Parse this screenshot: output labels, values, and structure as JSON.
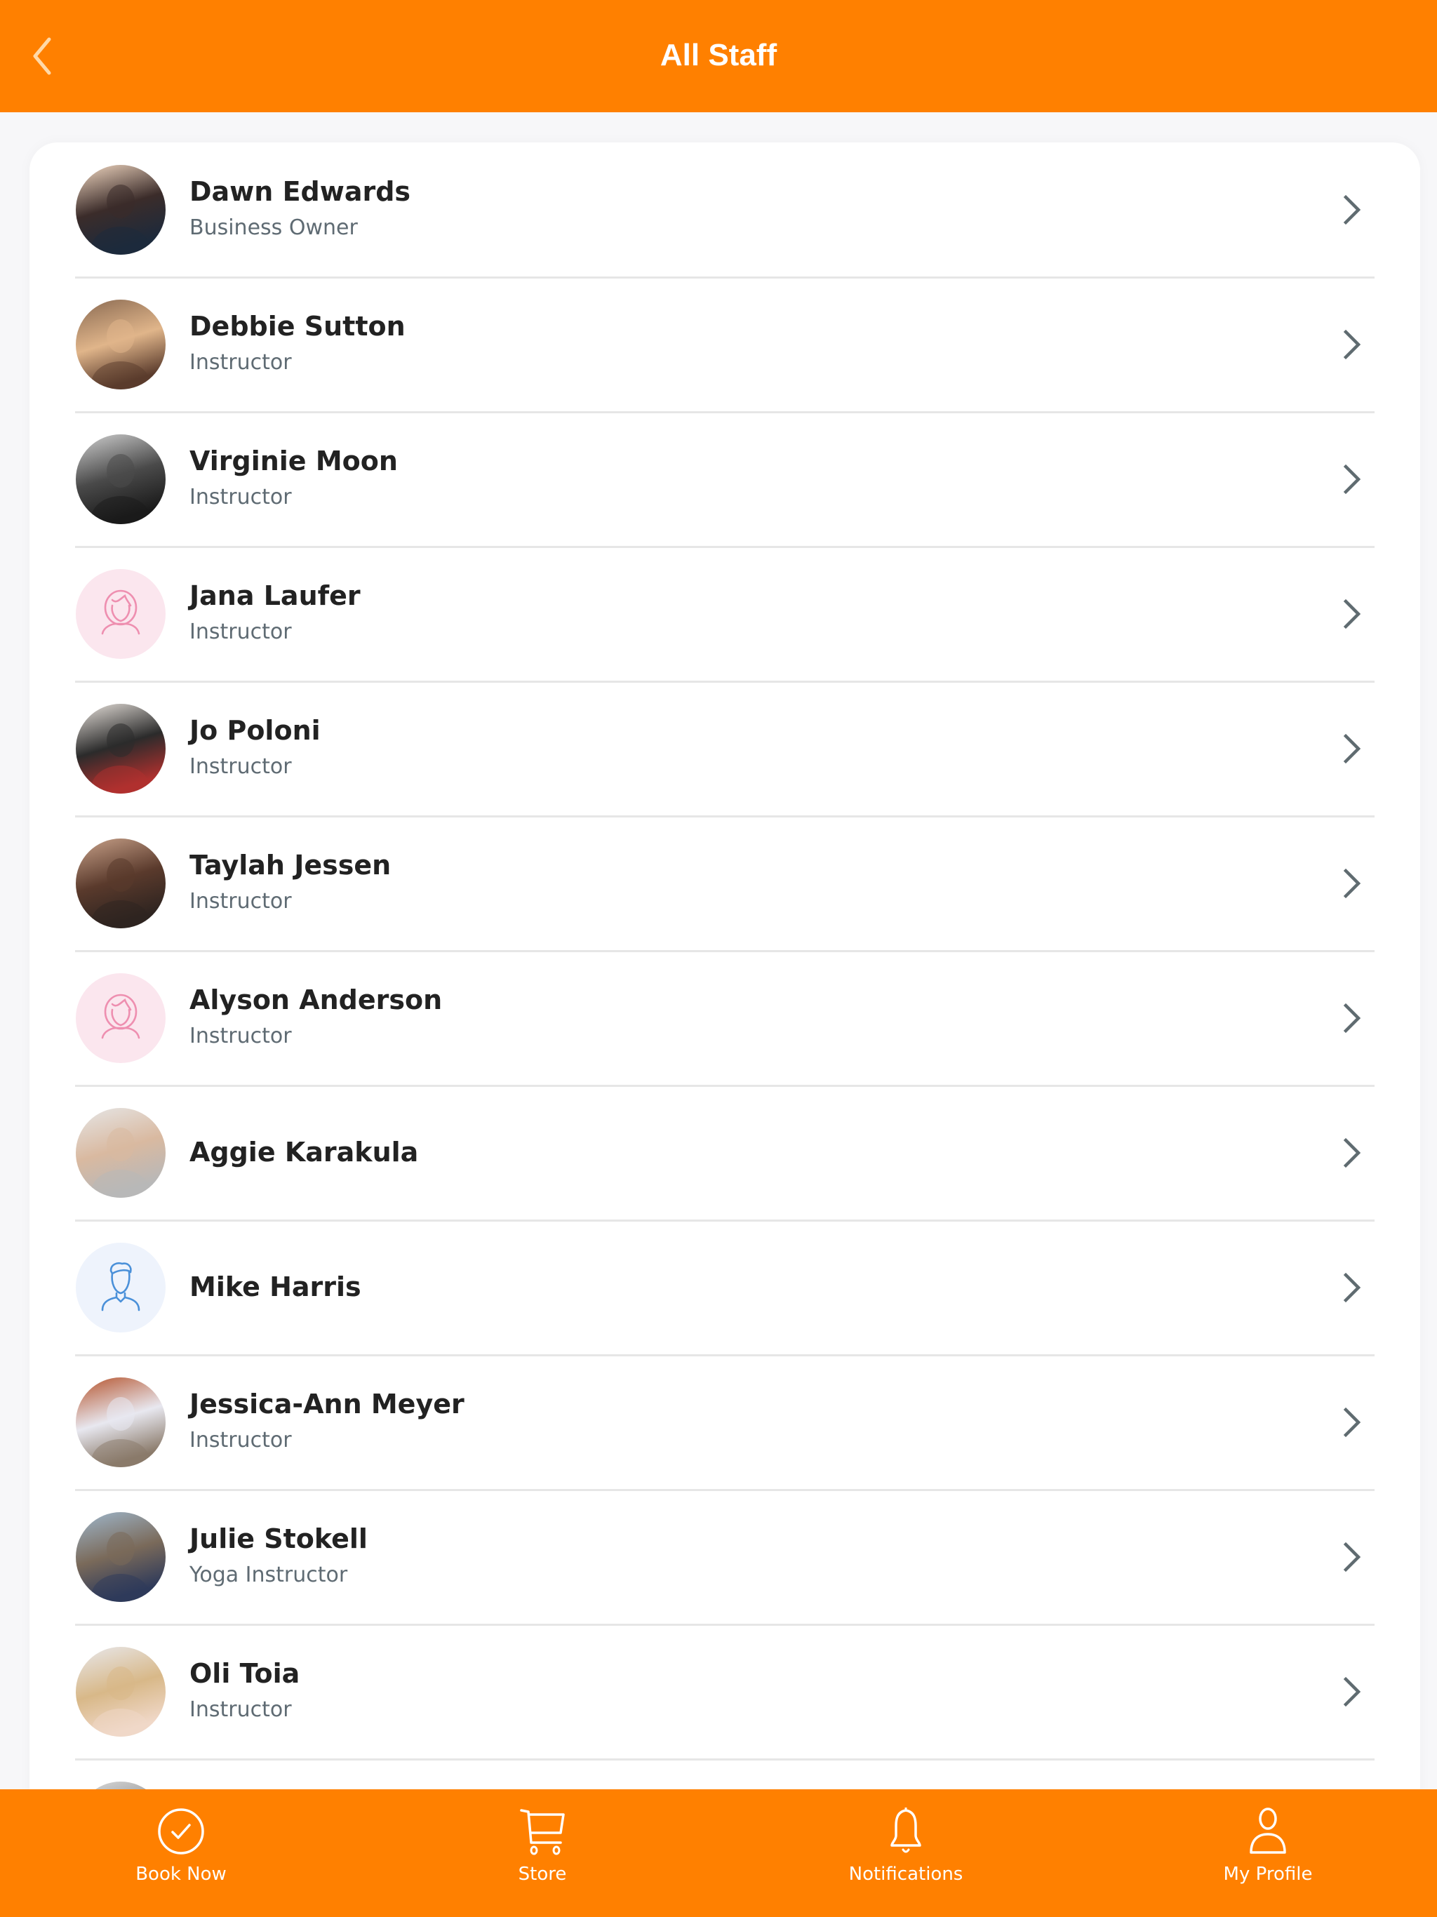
{
  "header": {
    "title": "All Staff",
    "back_icon": "chevron-left-icon"
  },
  "colors": {
    "brand_orange": "#FF8000",
    "page_background": "#F7F7F9",
    "name_text": "#222222",
    "role_text": "#5F6B73",
    "chevron": "#5F6B70",
    "divider": "#E6E6E6",
    "female_placeholder_bg": "#FBE6EE",
    "female_placeholder_stroke": "#EE8FB0",
    "male_placeholder_bg": "#EEF3FC",
    "male_placeholder_stroke": "#4A90D9"
  },
  "staff": [
    {
      "name": "Dawn Edwards",
      "role": "Business Owner",
      "avatar": "photo",
      "photo_tint": [
        "#f3d9c2",
        "#3b2c2a",
        "#1c2a3c"
      ]
    },
    {
      "name": "Debbie Sutton",
      "role": "Instructor",
      "avatar": "photo",
      "photo_tint": [
        "#8a6a52",
        "#e0b58a",
        "#5a3b2c"
      ]
    },
    {
      "name": "Virginie Moon",
      "role": "Instructor",
      "avatar": "photo",
      "photo_tint": [
        "#d0d0d0",
        "#4a4a4a",
        "#1a1a1a"
      ]
    },
    {
      "name": "Jana Laufer",
      "role": "Instructor",
      "avatar": "placeholder-female"
    },
    {
      "name": "Jo Poloni",
      "role": "Instructor",
      "avatar": "photo",
      "photo_tint": [
        "#e8e2dc",
        "#2b2b2b",
        "#b0302e"
      ]
    },
    {
      "name": "Taylah Jessen",
      "role": "Instructor",
      "avatar": "photo",
      "photo_tint": [
        "#c9a28a",
        "#5a3a2c",
        "#2e2420"
      ]
    },
    {
      "name": "Alyson Anderson",
      "role": "Instructor",
      "avatar": "placeholder-female"
    },
    {
      "name": "Aggie Karakula",
      "role": "",
      "avatar": "photo",
      "photo_tint": [
        "#e6e6e6",
        "#d9b9a0",
        "#b8b8b8"
      ]
    },
    {
      "name": "Mike Harris",
      "role": "",
      "avatar": "placeholder-male"
    },
    {
      "name": "Jessica-Ann Meyer",
      "role": "Instructor",
      "avatar": "photo",
      "photo_tint": [
        "#b5532c",
        "#e8e8f0",
        "#8a7a6a"
      ]
    },
    {
      "name": "Julie Stokell",
      "role": "Yoga Instructor",
      "avatar": "photo",
      "photo_tint": [
        "#9fb7cc",
        "#7a6a5a",
        "#2e3a5a"
      ]
    },
    {
      "name": "Oli Toia",
      "role": "Instructor",
      "avatar": "photo",
      "photo_tint": [
        "#e8e8ec",
        "#d8b888",
        "#f0d8c8"
      ]
    },
    {
      "name": "",
      "role": "",
      "avatar": "photo",
      "photo_tint": [
        "#dcdcdc",
        "#8a8a8a",
        "#4a4a4a"
      ]
    }
  ],
  "row_chevron_icon": "chevron-right-icon",
  "bottom_nav": [
    {
      "label": "Book Now",
      "icon": "check-circle-icon"
    },
    {
      "label": "Store",
      "icon": "cart-icon"
    },
    {
      "label": "Notifications",
      "icon": "bell-icon"
    },
    {
      "label": "My Profile",
      "icon": "profile-icon"
    }
  ]
}
